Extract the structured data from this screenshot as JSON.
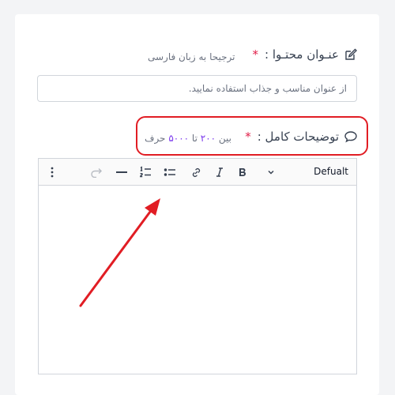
{
  "title_field": {
    "label": "عنـوان محتـوا :",
    "required": "*",
    "hint": "ترجیحا به زبان فارسی",
    "placeholder": "از عنوان مناسب و جذاب استفاده نمایید.",
    "value": "",
    "icon": "edit-icon"
  },
  "description_field": {
    "label": "توضیحات کامل :",
    "required": "*",
    "hint_prefix": "بین",
    "hint_min": "۲۰۰",
    "hint_mid": "تا",
    "hint_max": "۵۰۰۰",
    "hint_suffix": "حرف",
    "icon": "comment-icon"
  },
  "toolbar": {
    "format_label": "Defualt",
    "buttons": [
      "chevron-down-icon",
      "bold-icon",
      "italic-icon",
      "link-icon",
      "bullet-list-icon",
      "numbered-list-icon",
      "horizontal-line-icon",
      "redo-icon",
      "more-vertical-icon"
    ]
  },
  "annotation": {
    "highlight_color": "#e11d24",
    "arrow_color": "#e11d24"
  }
}
